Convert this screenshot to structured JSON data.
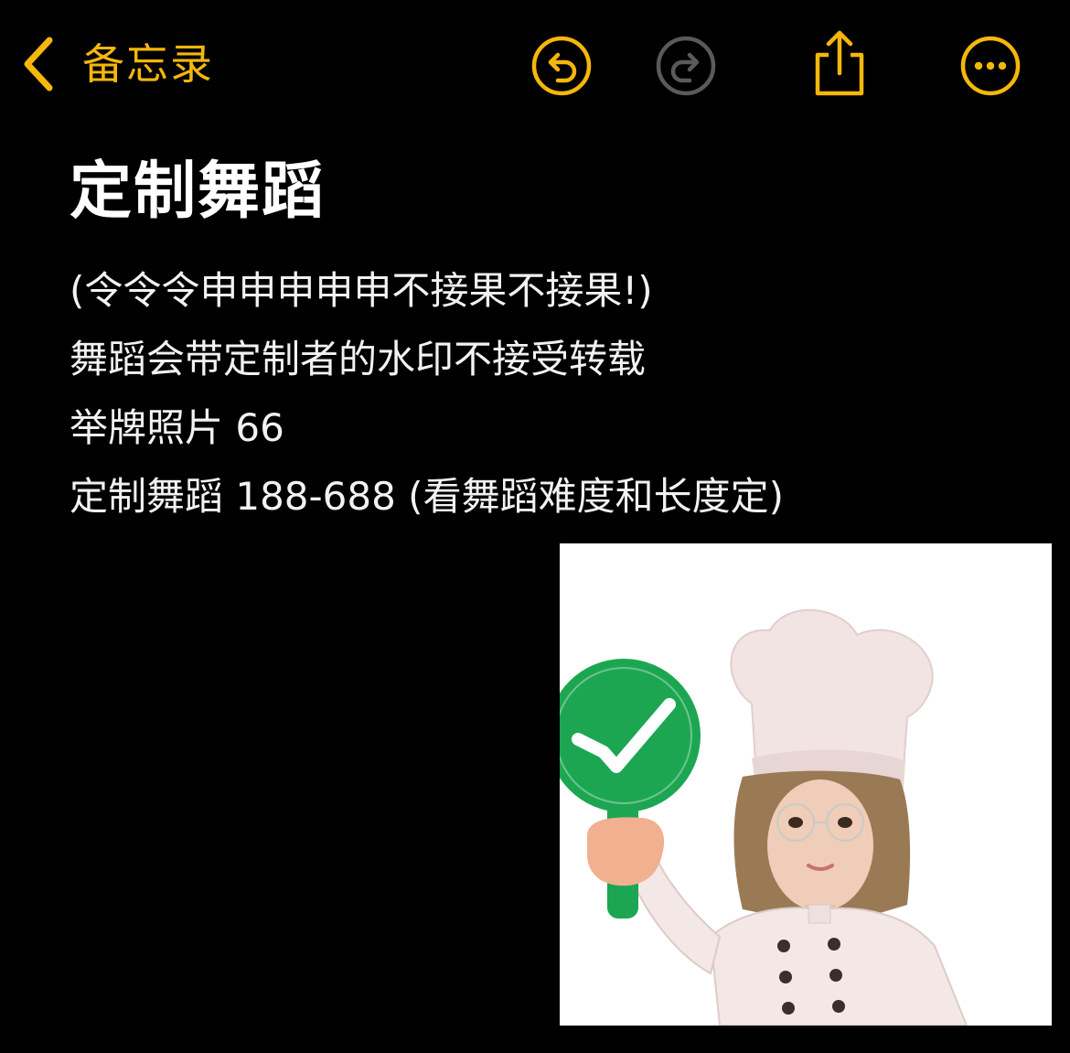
{
  "nav": {
    "back_label": "备忘录",
    "back_icon": "chevron-left-icon",
    "undo_icon": "undo-icon",
    "redo_icon": "redo-icon",
    "share_icon": "share-icon",
    "more_icon": "more-icon",
    "accent_color": "#F5B70C",
    "disabled_color": "#5a5a5a"
  },
  "note": {
    "title": "定制舞蹈",
    "lines": [
      "(令令令申申申申申不接果不接果!)",
      "舞蹈会带定制者的水印不接受转载",
      "举牌照片 66",
      "定制舞蹈 188-688 (看舞蹈难度和长度定)"
    ]
  },
  "image": {
    "description_icon": "chef-girl-holding-check-sign",
    "sign_color": "#1DA652"
  }
}
